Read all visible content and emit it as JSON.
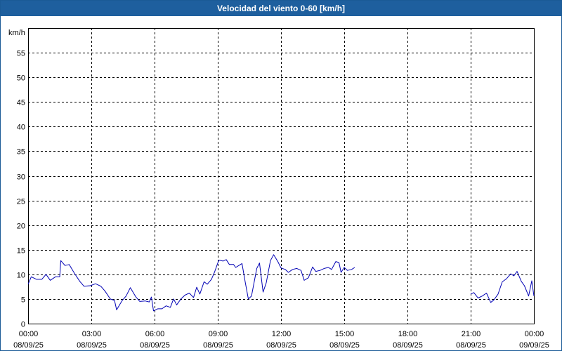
{
  "window": {
    "title": "Velocidad del viento 0-60 [km/h]"
  },
  "chart_data": {
    "type": "line",
    "title": "Velocidad del viento 0-60 [km/h]",
    "ylabel": "km/h",
    "xlabel": "",
    "ylim": [
      0,
      60
    ],
    "xlim_hours": [
      0,
      24
    ],
    "y_ticks": [
      0,
      5,
      10,
      15,
      20,
      25,
      30,
      35,
      40,
      45,
      50,
      55
    ],
    "x_ticks": [
      {
        "hour": 0,
        "time": "00:00",
        "date": "08/09/25"
      },
      {
        "hour": 3,
        "time": "03:00",
        "date": "08/09/25"
      },
      {
        "hour": 6,
        "time": "06:00",
        "date": "08/09/25"
      },
      {
        "hour": 9,
        "time": "09:00",
        "date": "08/09/25"
      },
      {
        "hour": 12,
        "time": "12:00",
        "date": "08/09/25"
      },
      {
        "hour": 15,
        "time": "15:00",
        "date": "08/09/25"
      },
      {
        "hour": 18,
        "time": "18:00",
        "date": "08/09/25"
      },
      {
        "hour": 21,
        "time": "21:00",
        "date": "08/09/25"
      },
      {
        "hour": 24,
        "time": "00:00",
        "date": "09/09/25"
      }
    ],
    "grid": true,
    "line_color": "#0000b4",
    "series": [
      {
        "segment": 1,
        "points": [
          [
            0.0,
            8.0
          ],
          [
            0.15,
            9.5
          ],
          [
            0.4,
            9.0
          ],
          [
            0.65,
            9.0
          ],
          [
            0.85,
            10.0
          ],
          [
            1.05,
            8.8
          ],
          [
            1.3,
            9.5
          ],
          [
            1.5,
            9.5
          ],
          [
            1.55,
            12.8
          ],
          [
            1.75,
            11.8
          ],
          [
            1.95,
            12.0
          ],
          [
            2.2,
            10.2
          ],
          [
            2.45,
            8.6
          ],
          [
            2.65,
            7.6
          ],
          [
            2.95,
            7.7
          ],
          [
            3.2,
            8.1
          ],
          [
            3.45,
            7.6
          ],
          [
            3.65,
            6.6
          ],
          [
            3.9,
            5.0
          ],
          [
            4.1,
            4.7
          ],
          [
            4.2,
            2.8
          ],
          [
            4.45,
            4.6
          ],
          [
            4.65,
            5.6
          ],
          [
            4.85,
            7.3
          ],
          [
            5.1,
            5.5
          ],
          [
            5.3,
            4.5
          ],
          [
            5.55,
            4.6
          ],
          [
            5.75,
            4.4
          ],
          [
            5.85,
            5.4
          ],
          [
            5.95,
            2.6
          ],
          [
            6.15,
            3.0
          ],
          [
            6.35,
            3.0
          ],
          [
            6.55,
            3.6
          ],
          [
            6.75,
            3.3
          ],
          [
            6.9,
            5.0
          ],
          [
            7.05,
            3.8
          ],
          [
            7.25,
            5.0
          ],
          [
            7.45,
            5.8
          ],
          [
            7.65,
            6.2
          ],
          [
            7.85,
            5.3
          ],
          [
            8.0,
            7.4
          ],
          [
            8.15,
            6.0
          ],
          [
            8.35,
            8.5
          ],
          [
            8.5,
            8.0
          ],
          [
            8.7,
            9.0
          ],
          [
            8.85,
            10.5
          ],
          [
            9.05,
            12.9
          ],
          [
            9.25,
            12.7
          ],
          [
            9.4,
            13.0
          ],
          [
            9.55,
            12.0
          ],
          [
            9.75,
            12.0
          ],
          [
            9.85,
            11.4
          ],
          [
            10.0,
            11.8
          ],
          [
            10.15,
            12.2
          ],
          [
            10.3,
            8.5
          ],
          [
            10.45,
            5.0
          ],
          [
            10.6,
            5.6
          ],
          [
            10.85,
            11.2
          ],
          [
            10.98,
            12.3
          ],
          [
            11.15,
            6.4
          ],
          [
            11.3,
            8.3
          ],
          [
            11.5,
            12.8
          ],
          [
            11.65,
            14.0
          ],
          [
            11.85,
            12.6
          ],
          [
            12.0,
            11.3
          ],
          [
            12.2,
            11.0
          ],
          [
            12.35,
            10.4
          ],
          [
            12.55,
            11.0
          ],
          [
            12.75,
            11.2
          ],
          [
            12.95,
            10.8
          ],
          [
            13.1,
            8.8
          ],
          [
            13.3,
            9.3
          ],
          [
            13.5,
            11.5
          ],
          [
            13.65,
            10.6
          ],
          [
            13.85,
            10.8
          ],
          [
            14.05,
            11.2
          ],
          [
            14.25,
            11.4
          ],
          [
            14.4,
            11.0
          ],
          [
            14.6,
            12.6
          ],
          [
            14.75,
            12.4
          ],
          [
            14.85,
            10.4
          ],
          [
            15.0,
            11.4
          ],
          [
            15.15,
            10.8
          ],
          [
            15.35,
            11.0
          ],
          [
            15.5,
            11.4
          ]
        ]
      },
      {
        "segment": 2,
        "points": [
          [
            21.0,
            6.0
          ],
          [
            21.15,
            6.3
          ],
          [
            21.35,
            5.2
          ],
          [
            21.55,
            5.6
          ],
          [
            21.75,
            6.2
          ],
          [
            21.95,
            4.3
          ],
          [
            22.1,
            4.8
          ],
          [
            22.3,
            6.0
          ],
          [
            22.5,
            8.5
          ],
          [
            22.7,
            9.1
          ],
          [
            22.9,
            10.1
          ],
          [
            23.05,
            9.7
          ],
          [
            23.2,
            10.6
          ],
          [
            23.4,
            8.6
          ],
          [
            23.55,
            7.7
          ],
          [
            23.75,
            5.6
          ],
          [
            23.9,
            8.7
          ],
          [
            24.0,
            5.6
          ]
        ]
      }
    ]
  }
}
